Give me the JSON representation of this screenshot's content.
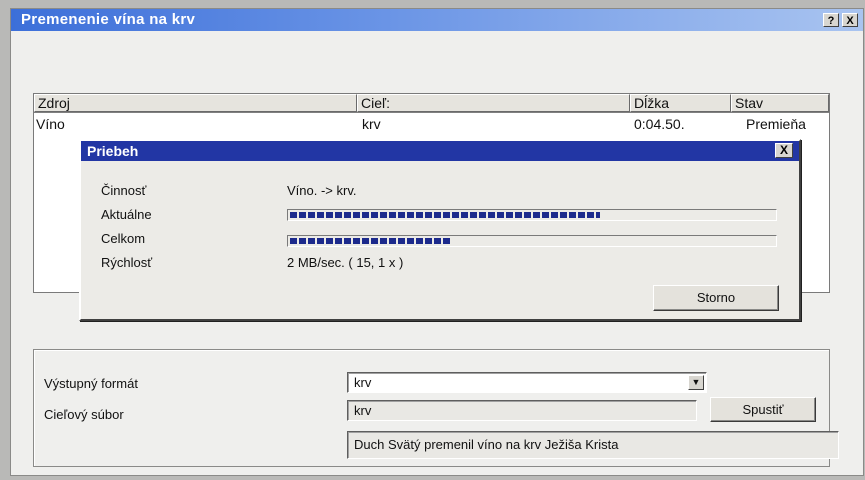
{
  "window": {
    "title": "Premenenie vína na krv",
    "help_label": "?",
    "close_label": "X"
  },
  "list": {
    "columns": [
      "Zdroj",
      "Cieľ:",
      "Dĺžka",
      "Stav"
    ],
    "rows": [
      {
        "zdroj": "Víno",
        "ciel": "krv",
        "dlzka": "0:04.50.",
        "stav": "Premieňa"
      }
    ]
  },
  "progress_dialog": {
    "title": "Priebeh",
    "close_label": "X",
    "activity_label": "Činnosť",
    "activity_value": "Víno. -> krv.",
    "current_label": "Aktuálne",
    "current_progress": 0.64,
    "total_label": "Celkom",
    "total_progress": 0.33,
    "speed_label": "Rýchlosť",
    "speed_value": "2 MB/sec. ( 15, 1 x )",
    "cancel_label": "Storno"
  },
  "output": {
    "format_label": "Výstupný formát",
    "format_value": "krv",
    "target_label": "Cieľový súbor",
    "target_value": "krv",
    "start_label": "Spustiť",
    "status_text": "Duch Svätý premenil víno na krv Ježiša Krista"
  },
  "colors": {
    "titlebar_start": "#3c6fd9",
    "dialog_titlebar": "#2236a4",
    "progress_fill": "#1c2a8c"
  }
}
